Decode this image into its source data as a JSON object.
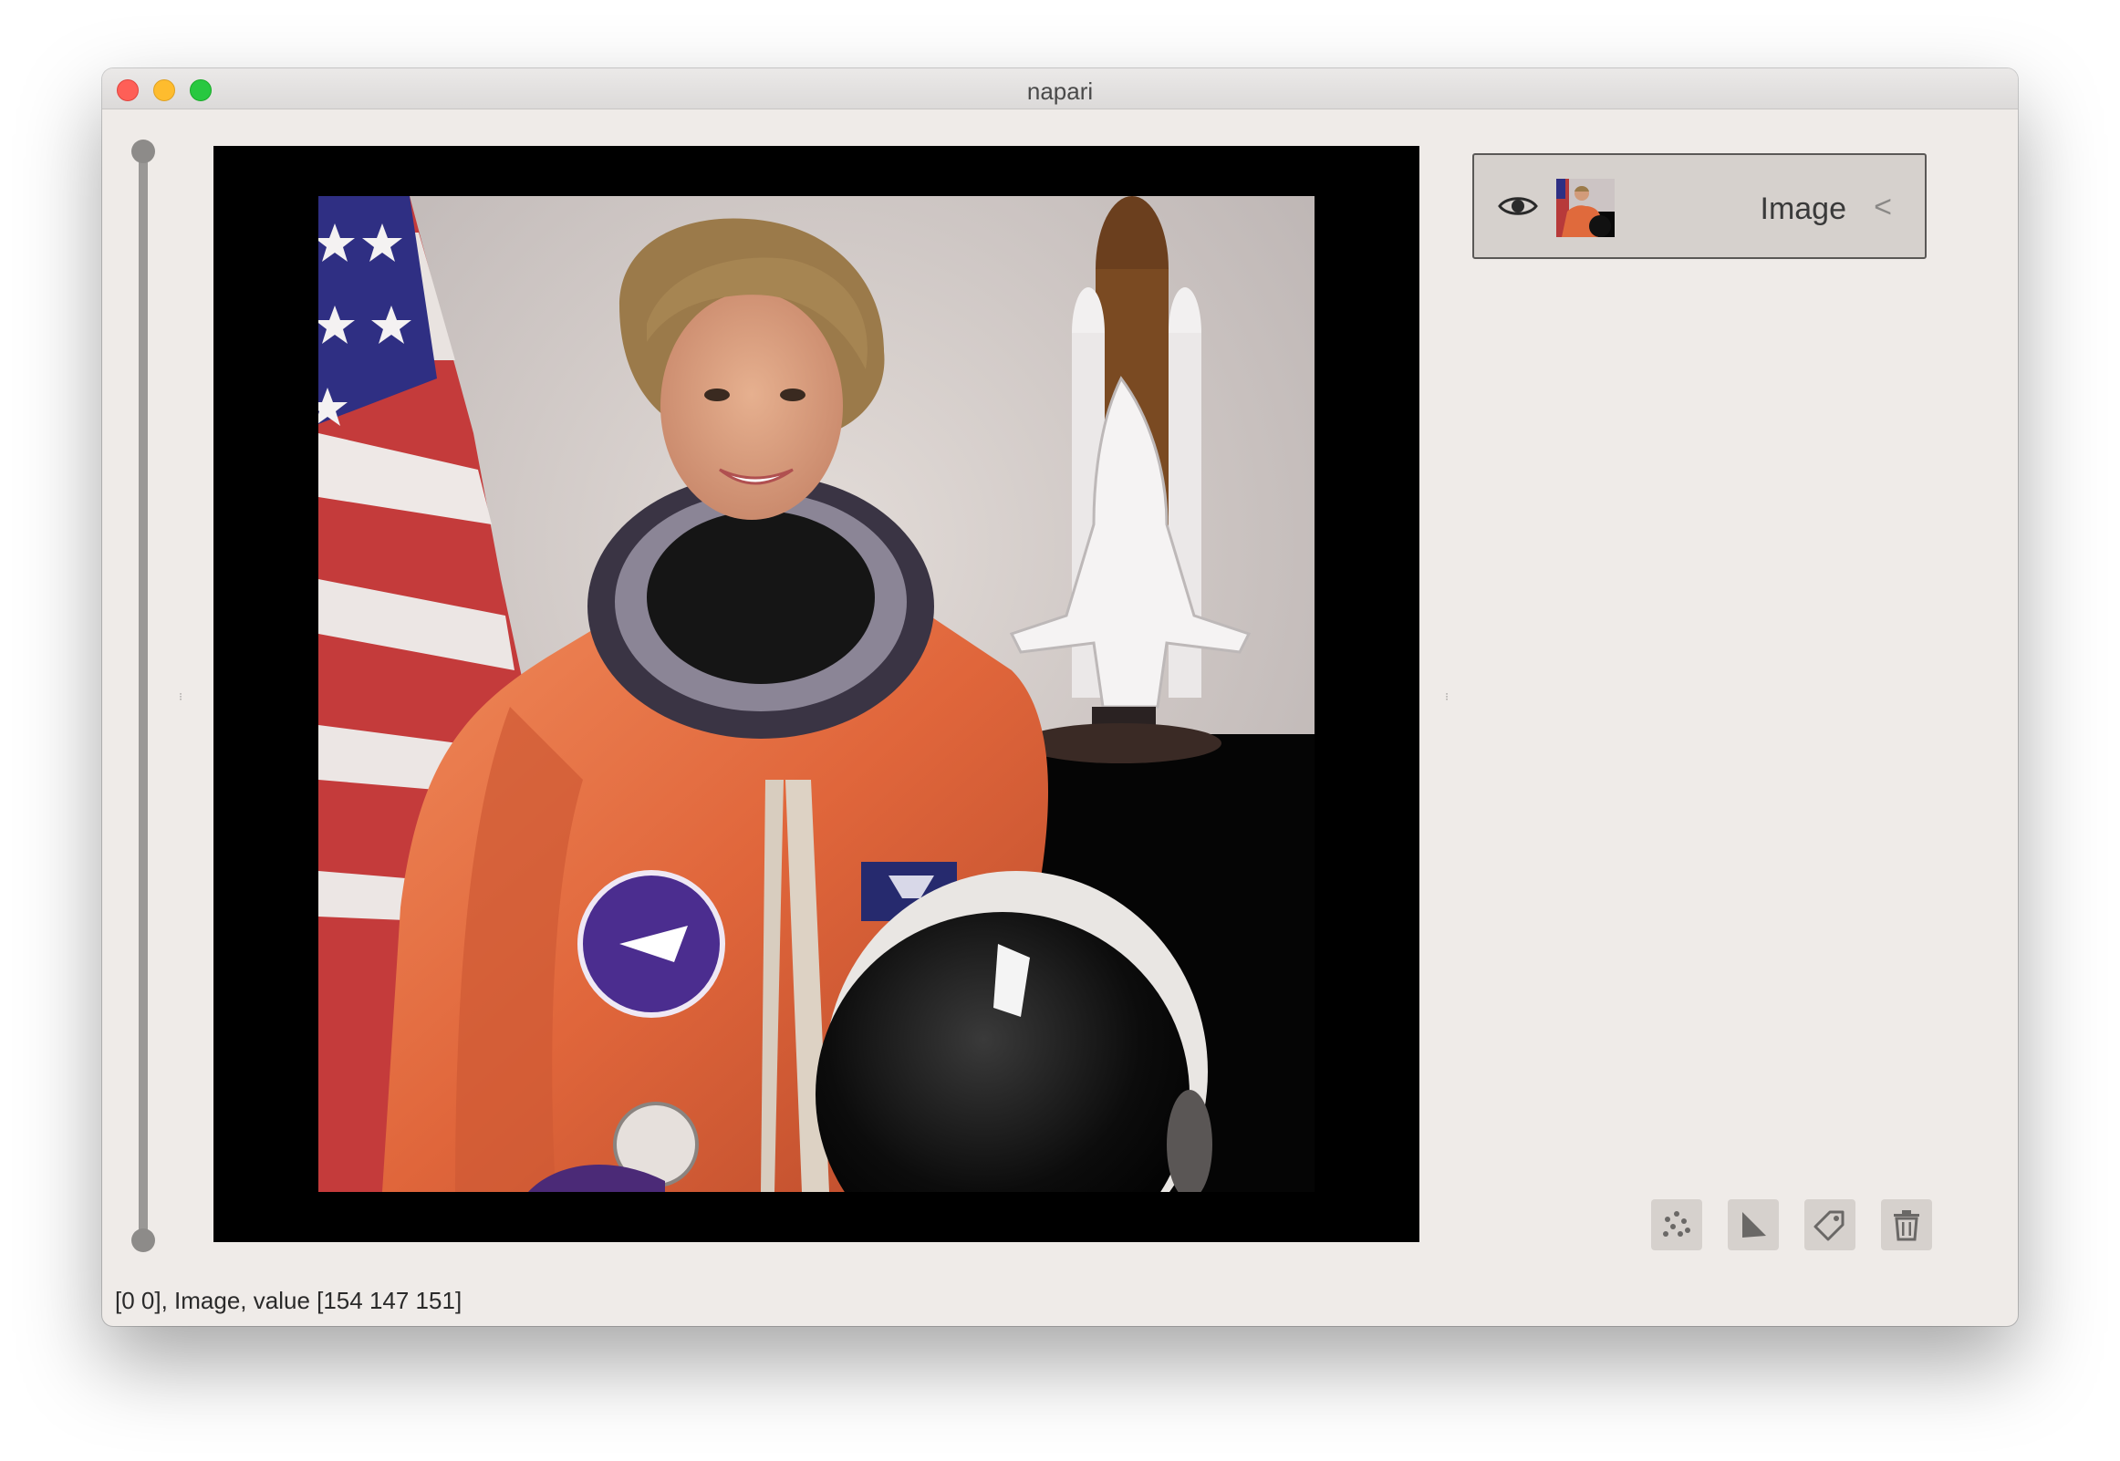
{
  "window": {
    "title": "napari"
  },
  "layers": {
    "items": [
      {
        "name": "Image",
        "visible": true,
        "icon": "eye-icon",
        "expand_icon": "chevron-left-icon"
      }
    ]
  },
  "layer_buttons": [
    {
      "name": "new-points-layer-button",
      "icon": "points-icon"
    },
    {
      "name": "new-shapes-layer-button",
      "icon": "shapes-icon"
    },
    {
      "name": "new-labels-layer-button",
      "icon": "label-tag-icon"
    },
    {
      "name": "delete-layer-button",
      "icon": "trash-icon"
    }
  ],
  "status": {
    "text": "[0 0], Image, value [154 147 151]"
  },
  "colors": {
    "window_bg": "#efebe8",
    "canvas_bg": "#000000",
    "layer_selected_bg": "#d6d1cd",
    "close": "#fe5f57",
    "minimize": "#febc2e",
    "maximize": "#28c840"
  }
}
